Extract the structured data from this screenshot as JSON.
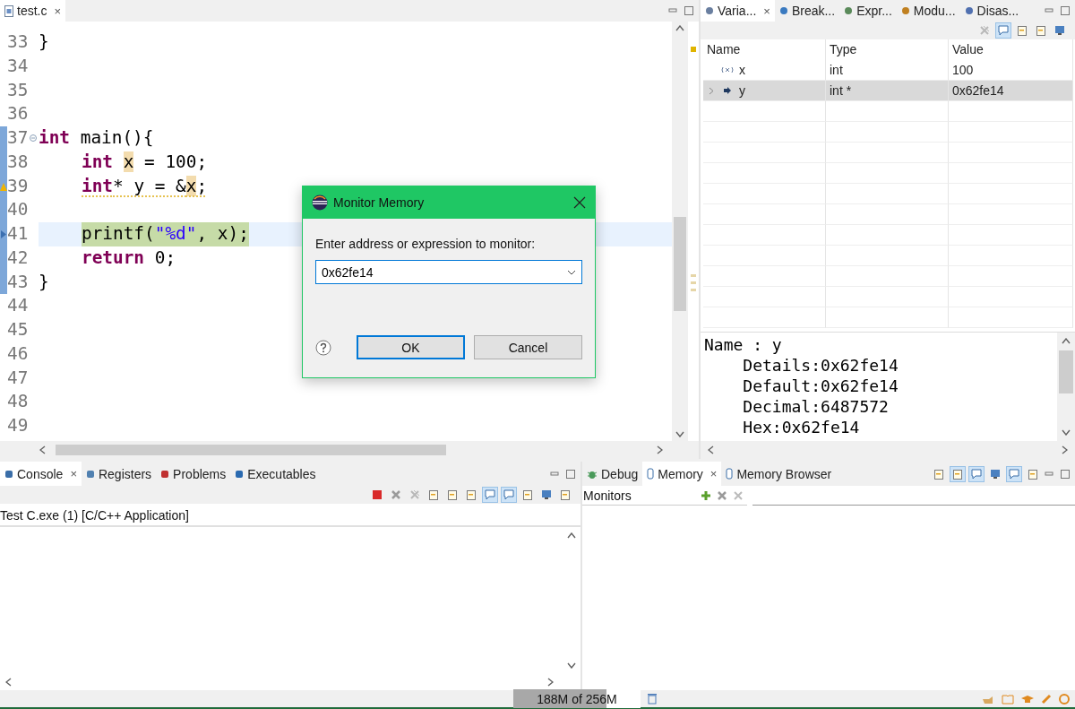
{
  "editor": {
    "tab": {
      "label": "test.c",
      "close": "×",
      "selected": true
    },
    "lines": [
      {
        "number": "33",
        "in_scope": false,
        "foldable": false,
        "warning": false,
        "instruction_pointer": false,
        "current": false,
        "indented": false,
        "tokens": [
          {
            "kind": "plain",
            "text": "}"
          }
        ]
      },
      {
        "number": "34",
        "in_scope": false,
        "foldable": false,
        "warning": false,
        "instruction_pointer": false,
        "current": false
      },
      {
        "number": "35",
        "in_scope": false,
        "foldable": false,
        "warning": false,
        "instruction_pointer": false,
        "current": false
      },
      {
        "number": "36",
        "in_scope": false,
        "foldable": false,
        "warning": false,
        "instruction_pointer": false,
        "current": false
      },
      {
        "number": "37",
        "in_scope": true,
        "foldable": true,
        "warning": false,
        "instruction_pointer": false,
        "current": false,
        "indented": false,
        "tokens": [
          {
            "kind": "keyword",
            "text": "int"
          },
          {
            "kind": "plain",
            "text": " main(){"
          }
        ]
      },
      {
        "number": "38",
        "in_scope": true,
        "foldable": false,
        "warning": false,
        "instruction_pointer": false,
        "current": false,
        "indented": true,
        "tokens": [
          {
            "kind": "keyword",
            "text": "int "
          },
          {
            "kind": "occurrence",
            "text": "x"
          },
          {
            "kind": "plain",
            "text": " = 100;"
          }
        ]
      },
      {
        "number": "39",
        "in_scope": true,
        "foldable": false,
        "warning": true,
        "instruction_pointer": false,
        "current": false,
        "indented": true,
        "tokens": [
          {
            "kind": "keyword",
            "text": "int"
          },
          {
            "kind": "plain",
            "text": "* y = &"
          },
          {
            "kind": "occurrence",
            "text": "x"
          },
          {
            "kind": "plain",
            "text": ";"
          }
        ]
      },
      {
        "number": "40",
        "in_scope": true,
        "foldable": false,
        "warning": false,
        "instruction_pointer": false,
        "current": false
      },
      {
        "number": "41",
        "in_scope": true,
        "foldable": false,
        "warning": false,
        "instruction_pointer": true,
        "current": true,
        "indented": true,
        "tokens": [
          {
            "kind": "plain",
            "text": "printf("
          },
          {
            "kind": "string",
            "text": "\"%d\""
          },
          {
            "kind": "plain",
            "text": ", x);"
          }
        ]
      },
      {
        "number": "42",
        "in_scope": true,
        "foldable": false,
        "warning": false,
        "instruction_pointer": false,
        "current": false,
        "indented": true,
        "tokens": [
          {
            "kind": "keyword",
            "text": "return"
          },
          {
            "kind": "plain",
            "text": " 0;"
          }
        ]
      },
      {
        "number": "43",
        "in_scope": true,
        "foldable": false,
        "warning": false,
        "instruction_pointer": false,
        "current": false,
        "indented": false,
        "tokens": [
          {
            "kind": "plain",
            "text": "}"
          }
        ]
      },
      {
        "number": "44",
        "in_scope": false,
        "foldable": false,
        "warning": false,
        "instruction_pointer": false,
        "current": false
      },
      {
        "number": "45",
        "in_scope": false,
        "foldable": false,
        "warning": false,
        "instruction_pointer": false,
        "current": false
      },
      {
        "number": "46",
        "in_scope": false,
        "foldable": false,
        "warning": false,
        "instruction_pointer": false,
        "current": false
      },
      {
        "number": "47",
        "in_scope": false,
        "foldable": false,
        "warning": false,
        "instruction_pointer": false,
        "current": false
      },
      {
        "number": "48",
        "in_scope": false,
        "foldable": false,
        "warning": false,
        "instruction_pointer": false,
        "current": false
      },
      {
        "number": "49",
        "in_scope": false,
        "foldable": false,
        "warning": false,
        "instruction_pointer": false,
        "current": false
      }
    ]
  },
  "variables_view": {
    "tabs": [
      {
        "label": "Varia...",
        "close": "×",
        "selected": true
      },
      {
        "label": "Break...",
        "selected": false
      },
      {
        "label": "Expr...",
        "selected": false
      },
      {
        "label": "Modu...",
        "selected": false
      },
      {
        "label": "Disas...",
        "selected": false
      }
    ],
    "toolbar": [
      {
        "kind": "remove-all",
        "on": false
      },
      {
        "kind": "chat",
        "on": true
      },
      {
        "kind": "doc",
        "on": false
      },
      {
        "kind": "doc",
        "on": false
      },
      {
        "kind": "monitor",
        "on": false
      }
    ],
    "columns": [
      "Name",
      "Type",
      "Value"
    ],
    "rows": [
      {
        "kind": "variable",
        "name": "x",
        "type": "int",
        "value": "100",
        "expandable": false,
        "selected": false
      },
      {
        "kind": "pointer",
        "name": "y",
        "type": "int *",
        "value": "0x62fe14",
        "expandable": true,
        "selected": true
      }
    ],
    "details": [
      "Name : y",
      "    Details:0x62fe14",
      "    Default:0x62fe14",
      "    Decimal:6487572",
      "    Hex:0x62fe14"
    ]
  },
  "dialog": {
    "title": "Monitor Memory",
    "prompt": "Enter address or expression to monitor:",
    "value": "0x62fe14",
    "buttons": [
      {
        "label": "OK",
        "default": true
      },
      {
        "label": "Cancel",
        "default": false
      }
    ]
  },
  "console_view": {
    "tabs": [
      {
        "label": "Console",
        "close": "×",
        "selected": true
      },
      {
        "label": "Registers",
        "selected": false
      },
      {
        "label": "Problems",
        "selected": false
      },
      {
        "label": "Executables",
        "selected": false
      }
    ],
    "toolbar": [
      {
        "kind": "stop",
        "on": false
      },
      {
        "kind": "remove",
        "on": false
      },
      {
        "kind": "remove-all",
        "on": false
      },
      {
        "kind": "doc",
        "on": false
      },
      {
        "kind": "doc",
        "on": false
      },
      {
        "kind": "doc",
        "on": false
      },
      {
        "kind": "chat",
        "on": true
      },
      {
        "kind": "chat",
        "on": true
      },
      {
        "kind": "doc",
        "on": false
      },
      {
        "kind": "monitor",
        "on": false
      },
      {
        "kind": "doc",
        "on": false
      }
    ],
    "process": "Test C.exe (1) [C/C++ Application]"
  },
  "memory_view": {
    "tabs": [
      {
        "label": "Debug",
        "selected": false
      },
      {
        "label": "Memory",
        "close": "×",
        "selected": true
      },
      {
        "label": "Memory Browser",
        "selected": false
      }
    ],
    "toolbar": [
      {
        "kind": "doc",
        "on": false
      },
      {
        "kind": "doc",
        "on": true
      },
      {
        "kind": "chat",
        "on": true
      },
      {
        "kind": "monitor",
        "on": false
      },
      {
        "kind": "chat",
        "on": true
      },
      {
        "kind": "doc",
        "on": false
      }
    ],
    "monitors_label": "Monitors"
  },
  "status_bar": {
    "heap": {
      "text": "188M of 256M",
      "level": 0.73
    }
  }
}
